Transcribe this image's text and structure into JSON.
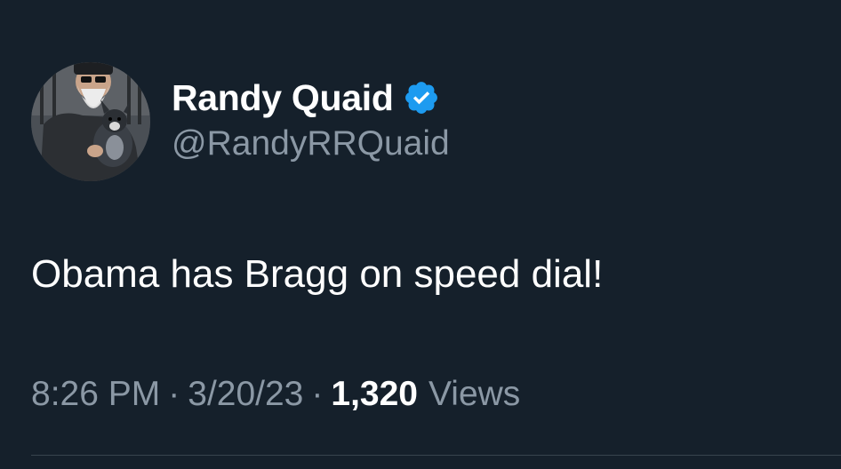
{
  "tweet": {
    "author": {
      "display_name": "Randy Quaid",
      "handle": "@RandyRRQuaid",
      "verified": true
    },
    "text": "Obama has Bragg on speed dial!",
    "time": "8:26 PM",
    "date": "3/20/23",
    "separator": "·",
    "views_count": "1,320",
    "views_label": "Views"
  },
  "colors": {
    "background": "#15202b",
    "primary_text": "#ffffff",
    "secondary_text": "#8b98a5",
    "verified_badge": "#1d9bf0",
    "divider": "#38444d"
  }
}
